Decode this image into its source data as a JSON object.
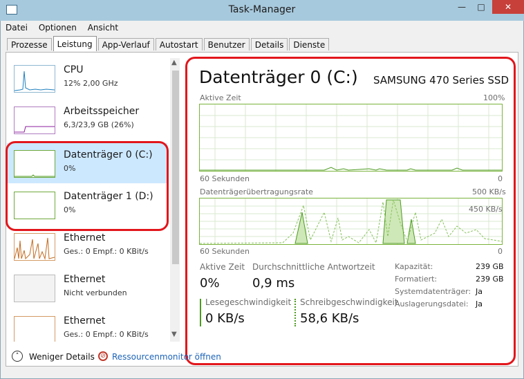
{
  "window": {
    "title": "Task-Manager",
    "minimize": "—",
    "maximize": "□",
    "close": "✕"
  },
  "menu": [
    "Datei",
    "Optionen",
    "Ansicht"
  ],
  "tabs": [
    "Prozesse",
    "Leistung",
    "App-Verlauf",
    "Autostart",
    "Benutzer",
    "Details",
    "Dienste"
  ],
  "active_tab": "Leistung",
  "sidebar": {
    "items": [
      {
        "name": "CPU",
        "sub": "12%  2,00 GHz",
        "color": "#1d7fbf"
      },
      {
        "name": "Arbeitsspeicher",
        "sub": "6,3/23,9 GB (26%)",
        "color": "#8b1c9c"
      },
      {
        "name": "Datenträger 0 (C:)",
        "sub": "0%",
        "color": "#4c9b1f"
      },
      {
        "name": "Datenträger 1 (D:)",
        "sub": "0%",
        "color": "#4c9b1f"
      },
      {
        "name": "Ethernet",
        "sub": "Ges.: 0  Empf.: 0 KBit/s",
        "color": "#c26a1e"
      },
      {
        "name": "Ethernet",
        "sub": "Nicht verbunden",
        "color": "#9a9a9a"
      },
      {
        "name": "Ethernet",
        "sub": "Ges.: 0  Empf.: 0 KBit/s",
        "color": "#c26a1e"
      }
    ]
  },
  "detail": {
    "title": "Datenträger 0 (C:)",
    "model": "SAMSUNG 470 Series SSD",
    "chart1": {
      "label": "Aktive Zeit",
      "max": "100%",
      "time": "60 Sekunden",
      "min": "0"
    },
    "chart2": {
      "label": "Datenträgerübertragungsrate",
      "max": "500 KB/s",
      "mid": "450 KB/s",
      "time": "60 Sekunden",
      "min": "0"
    },
    "active_time_label": "Aktive Zeit",
    "active_time_value": "0%",
    "response_label": "Durchschnittliche Antwortzeit",
    "response_value": "0,9 ms",
    "read_label": "Lesegeschwindigkeit",
    "read_value": "0 KB/s",
    "write_label": "Schreibgeschwindigkeit",
    "write_value": "58,6 KB/s",
    "properties": [
      {
        "label": "Kapazität:",
        "value": "239 GB"
      },
      {
        "label": "Formatiert:",
        "value": "239 GB"
      },
      {
        "label": "Systemdatenträger:",
        "value": "Ja"
      },
      {
        "label": "Auslagerungsdatei:",
        "value": "Ja"
      }
    ]
  },
  "footer": {
    "less_details": "Weniger Details",
    "resource_monitor": "Ressourcenmonitor öffnen"
  },
  "accent": "#e2161b",
  "disk_color": "#4c9b1f"
}
